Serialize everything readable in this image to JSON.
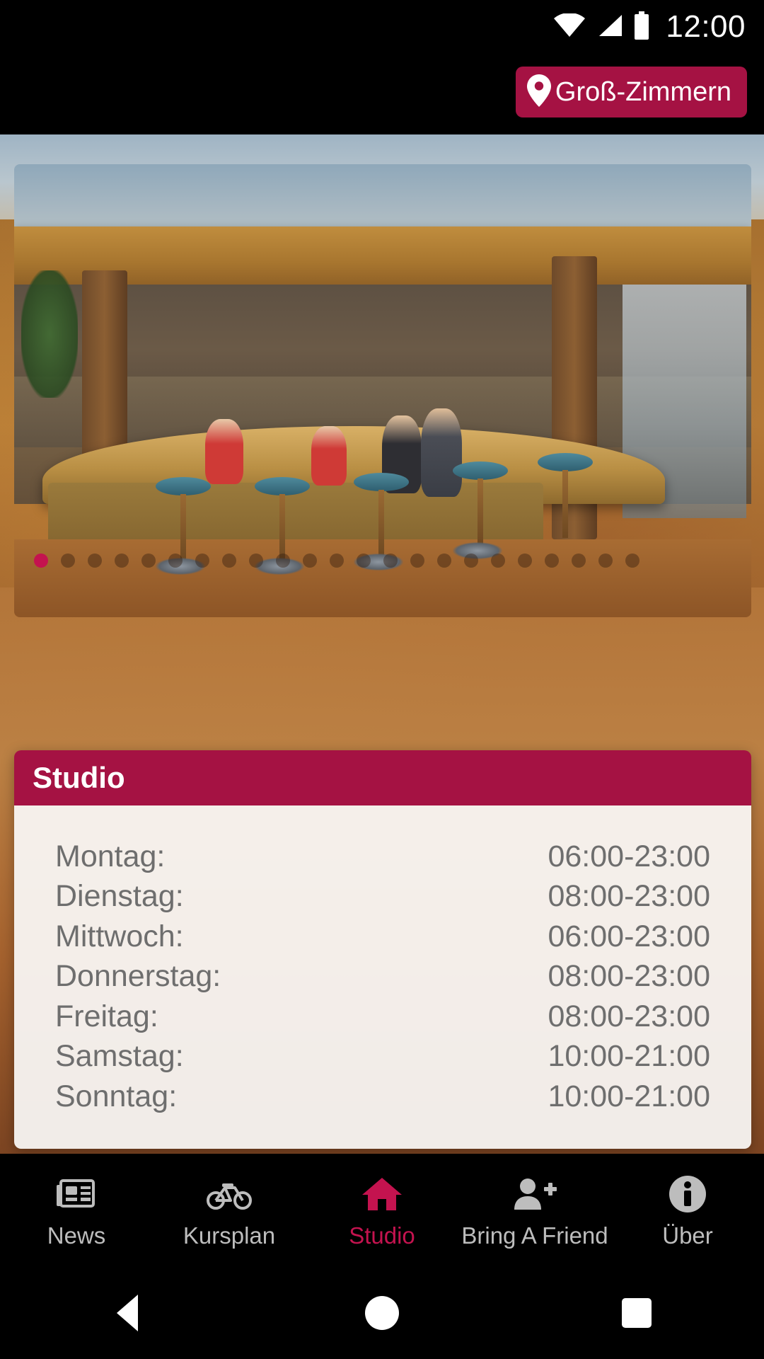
{
  "status_bar": {
    "time": "12:00",
    "icons": [
      "wifi-icon",
      "signal-icon",
      "battery-icon"
    ]
  },
  "location_badge": {
    "icon": "map-pin-icon",
    "label": "Groß-Zimmern"
  },
  "carousel": {
    "name": "studio-photo-carousel",
    "total_dots": 23,
    "active_index": 0,
    "active_dot_color": "#C4134F",
    "inactive_dot_color": "rgba(50,28,14,0.42)"
  },
  "card": {
    "title": "Studio",
    "header_color": "#A51243",
    "hours": [
      {
        "day": "Montag:",
        "time": "06:00-23:00"
      },
      {
        "day": "Dienstag:",
        "time": "08:00-23:00"
      },
      {
        "day": "Mittwoch:",
        "time": "06:00-23:00"
      },
      {
        "day": "Donnerstag:",
        "time": "08:00-23:00"
      },
      {
        "day": "Freitag:",
        "time": "08:00-23:00"
      },
      {
        "day": "Samstag:",
        "time": "10:00-21:00"
      },
      {
        "day": "Sonntag:",
        "time": "10:00-21:00"
      }
    ]
  },
  "bottom_nav": {
    "active_color": "#C4134F",
    "inactive_color": "#BDBDBD",
    "items": [
      {
        "label": "News",
        "icon": "newspaper-icon",
        "active": false
      },
      {
        "label": "Kursplan",
        "icon": "bicycle-icon",
        "active": false
      },
      {
        "label": "Studio",
        "icon": "home-icon",
        "active": true
      },
      {
        "label": "Bring A Friend",
        "icon": "person-add-icon",
        "active": false
      },
      {
        "label": "Über",
        "icon": "info-icon",
        "active": false
      }
    ]
  },
  "system_nav": {
    "buttons": [
      "back-triangle-icon",
      "home-circle-icon",
      "recents-square-icon"
    ]
  }
}
